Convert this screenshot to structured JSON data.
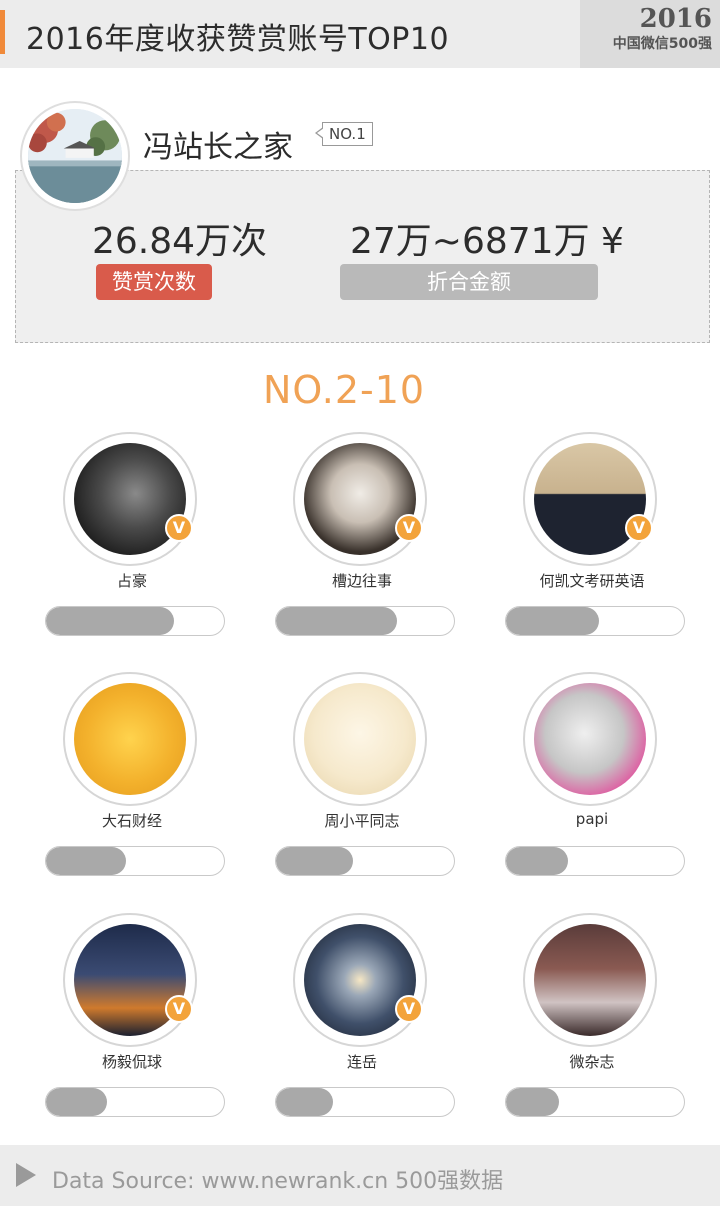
{
  "header": {
    "title": "2016年度收获赞赏账号TOP10",
    "badge_year": "2016",
    "badge_sub": "中国微信500强"
  },
  "top": {
    "name": "冯站长之家",
    "rank_tag": "NO.1",
    "reward_count": "26.84万次",
    "reward_amount": "27万~6871万 ¥",
    "reward_count_label": "赞赏次数",
    "reward_amount_label": "折合金额"
  },
  "section_title": "NO.2-10",
  "items": [
    {
      "name": "占豪",
      "verified": true,
      "bar": 0.72
    },
    {
      "name": "槽边往事",
      "verified": true,
      "bar": 0.68
    },
    {
      "name": "何凯文考研英语",
      "verified": true,
      "bar": 0.52
    },
    {
      "name": "大石财经",
      "verified": false,
      "bar": 0.45
    },
    {
      "name": "周小平同志",
      "verified": false,
      "bar": 0.43
    },
    {
      "name": "papi",
      "verified": false,
      "bar": 0.35
    },
    {
      "name": "杨毅侃球",
      "verified": true,
      "bar": 0.34
    },
    {
      "name": "连岳",
      "verified": true,
      "bar": 0.32
    },
    {
      "name": "微杂志",
      "verified": false,
      "bar": 0.3
    }
  ],
  "footer": {
    "text": "Data Source: www.newrank.cn  500强数据"
  },
  "colors": {
    "accent": "#f08a3a",
    "red_pill": "#d95b4b",
    "gray_pill": "#b9b9b9",
    "section_title": "#f0a255",
    "bar_fill": "#a9a9a9",
    "verified_badge": "#f3a33a"
  }
}
